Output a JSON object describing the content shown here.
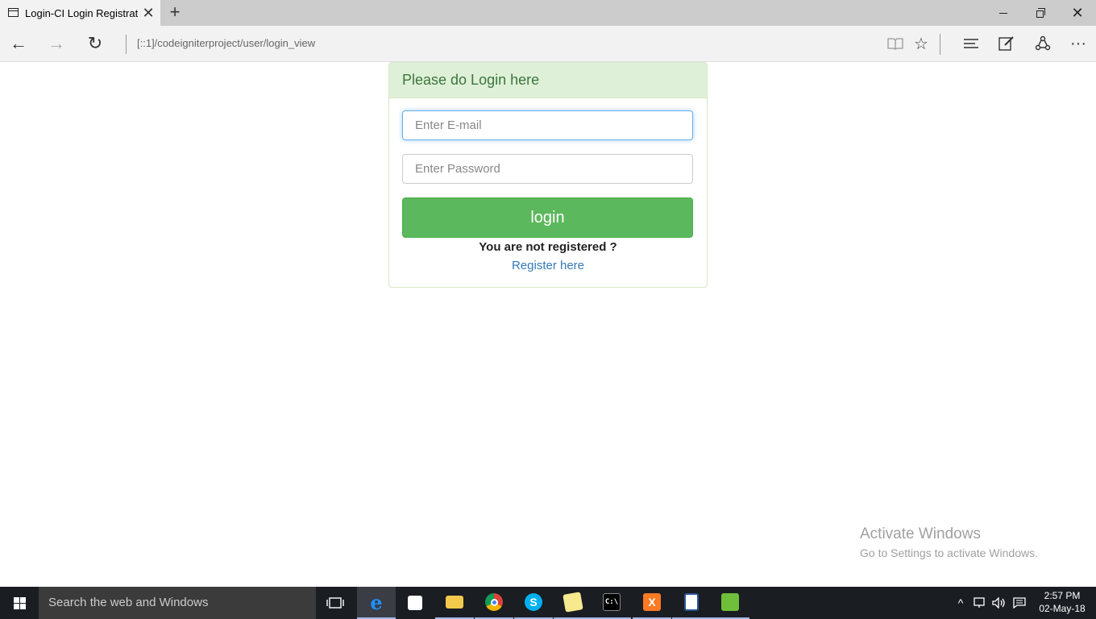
{
  "browser": {
    "tab_title": "Login-CI Login Registrat",
    "tab_close": "✕",
    "new_tab": "+",
    "address": "[::1]/codeigniterproject/user/login_view"
  },
  "panel": {
    "heading": "Please do Login here",
    "email_placeholder": "Enter E-mail",
    "password_placeholder": "Enter Password",
    "login_label": "login",
    "not_registered": "You are not registered ?",
    "register_link": "Register here"
  },
  "watermark": {
    "title": "Activate Windows",
    "subtitle": "Go to Settings to activate Windows."
  },
  "taskbar": {
    "search_placeholder": "Search the web and Windows",
    "apps": [
      "task-view",
      "edge",
      "store",
      "file-explorer",
      "chrome",
      "skype",
      "sticky-notes",
      "command-prompt",
      "xampp",
      "notepad",
      "chart-app"
    ],
    "clock_time": "2:57 PM",
    "clock_date": "02-May-18"
  },
  "colors": {
    "success_heading_bg": "#dff0d8",
    "success_text": "#3c763d",
    "button_green": "#5cb85c",
    "link_blue": "#337ab7"
  }
}
